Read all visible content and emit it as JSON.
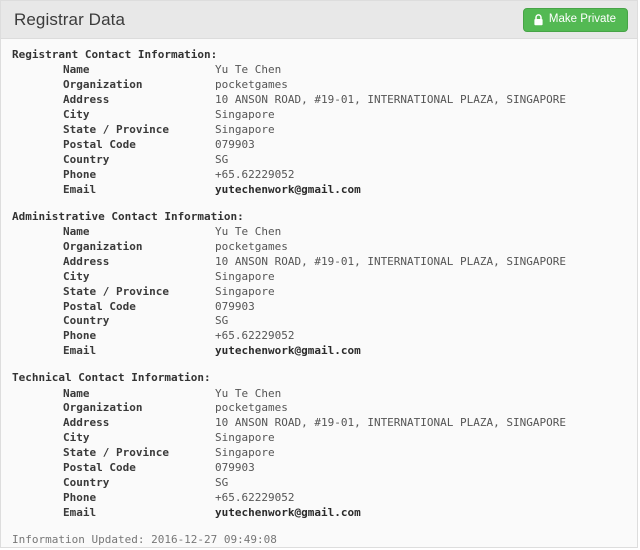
{
  "header": {
    "title": "Registrar Data",
    "make_private_label": "Make Private",
    "lock_icon": "lock-icon",
    "button_color": "#53b953"
  },
  "sections": [
    {
      "title": "Registrant Contact Information:",
      "fields": [
        {
          "label": "Name",
          "value": "Yu Te Chen",
          "type": "text"
        },
        {
          "label": "Organization",
          "value": "pocketgames",
          "type": "text"
        },
        {
          "label": "Address",
          "value": "10 ANSON ROAD, #19-01, INTERNATIONAL PLAZA, SINGAPORE",
          "type": "text"
        },
        {
          "label": "City",
          "value": "Singapore",
          "type": "text"
        },
        {
          "label": "State / Province",
          "value": "Singapore",
          "type": "text"
        },
        {
          "label": "Postal Code",
          "value": "079903",
          "type": "text"
        },
        {
          "label": "Country",
          "value": "SG",
          "type": "text"
        },
        {
          "label": "Phone",
          "value": "+65.62229052",
          "type": "text"
        },
        {
          "label": "Email",
          "value": "yutechenwork@gmail.com",
          "type": "email"
        }
      ]
    },
    {
      "title": "Administrative Contact Information:",
      "fields": [
        {
          "label": "Name",
          "value": "Yu Te Chen",
          "type": "text"
        },
        {
          "label": "Organization",
          "value": "pocketgames",
          "type": "text"
        },
        {
          "label": "Address",
          "value": "10 ANSON ROAD, #19-01, INTERNATIONAL PLAZA, SINGAPORE",
          "type": "text"
        },
        {
          "label": "City",
          "value": "Singapore",
          "type": "text"
        },
        {
          "label": "State / Province",
          "value": "Singapore",
          "type": "text"
        },
        {
          "label": "Postal Code",
          "value": "079903",
          "type": "text"
        },
        {
          "label": "Country",
          "value": "SG",
          "type": "text"
        },
        {
          "label": "Phone",
          "value": "+65.62229052",
          "type": "text"
        },
        {
          "label": "Email",
          "value": "yutechenwork@gmail.com",
          "type": "email"
        }
      ]
    },
    {
      "title": "Technical Contact Information:",
      "fields": [
        {
          "label": "Name",
          "value": "Yu Te Chen",
          "type": "text"
        },
        {
          "label": "Organization",
          "value": "pocketgames",
          "type": "text"
        },
        {
          "label": "Address",
          "value": "10 ANSON ROAD, #19-01, INTERNATIONAL PLAZA, SINGAPORE",
          "type": "text"
        },
        {
          "label": "City",
          "value": "Singapore",
          "type": "text"
        },
        {
          "label": "State / Province",
          "value": "Singapore",
          "type": "text"
        },
        {
          "label": "Postal Code",
          "value": "079903",
          "type": "text"
        },
        {
          "label": "Country",
          "value": "SG",
          "type": "text"
        },
        {
          "label": "Phone",
          "value": "+65.62229052",
          "type": "text"
        },
        {
          "label": "Email",
          "value": "yutechenwork@gmail.com",
          "type": "email"
        }
      ]
    }
  ],
  "footer": {
    "updated_text": "Information Updated: 2016-12-27 09:49:08"
  }
}
